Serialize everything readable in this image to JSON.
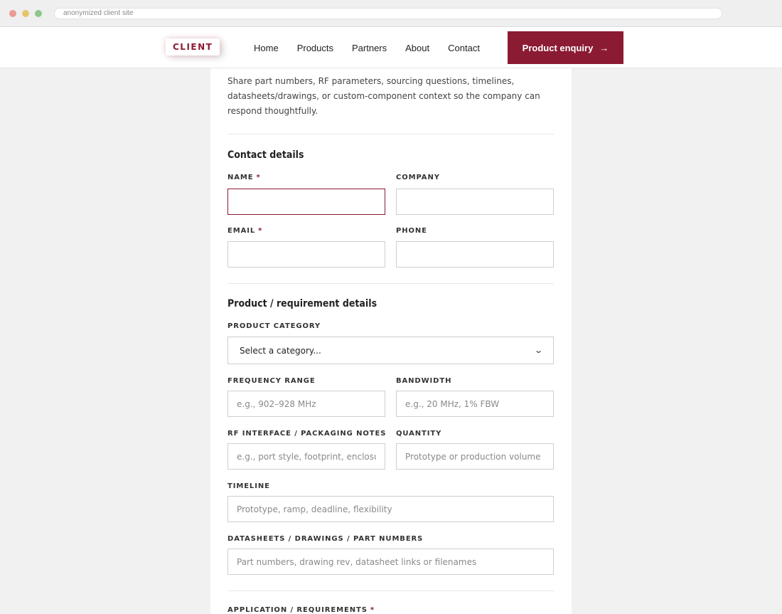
{
  "browser": {
    "url": "anonymized client site"
  },
  "header": {
    "logo": "CLIENT",
    "nav": [
      "Home",
      "Products",
      "Partners",
      "About",
      "Contact"
    ],
    "cta_label": "Product enquiry",
    "cta_icon": "arrow-right-icon"
  },
  "form": {
    "intro": "Share part numbers, RF parameters, sourcing questions, timelines, datasheets/drawings, or custom-component context so the company can respond thoughtfully.",
    "contact_section": {
      "title": "Contact details",
      "name_label": "NAME",
      "company_label": "COMPANY",
      "email_label": "EMAIL",
      "phone_label": "PHONE"
    },
    "product_section": {
      "title": "Product / requirement details",
      "category_label": "PRODUCT CATEGORY",
      "category_value": "Select a category...",
      "frequency_label": "FREQUENCY RANGE",
      "frequency_placeholder": "e.g., 902–928 MHz",
      "bandwidth_label": "BANDWIDTH",
      "bandwidth_placeholder": "e.g., 20 MHz, 1% FBW",
      "rf_label": "RF INTERFACE / PACKAGING NOTES",
      "rf_placeholder": "e.g., port style, footprint, enclosure",
      "quantity_label": "QUANTITY",
      "quantity_placeholder": "Prototype or production volume",
      "timeline_label": "TIMELINE",
      "timeline_placeholder": "Prototype, ramp, deadline, flexibility",
      "datasheets_label": "DATASHEETS / DRAWINGS / PART NUMBERS",
      "datasheets_placeholder": "Part numbers, drawing rev, datasheet links or filenames",
      "application_label": "APPLICATION / REQUIREMENTS"
    },
    "required_marker": "*"
  },
  "colors": {
    "accent": "#8b1a33",
    "page_bg": "#f1f1f1"
  }
}
